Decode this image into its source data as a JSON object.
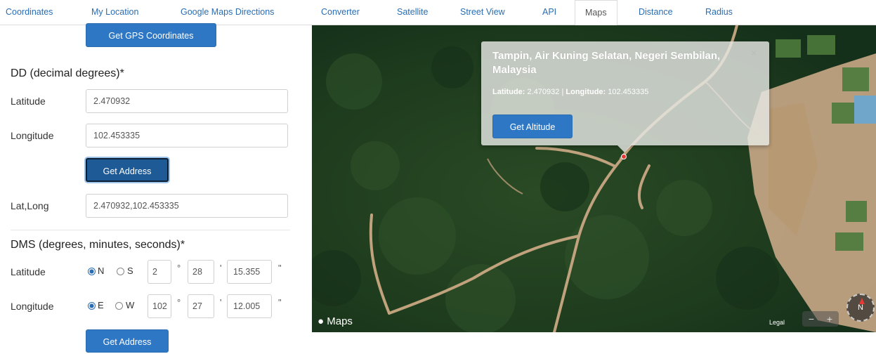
{
  "nav": {
    "tabs": [
      {
        "label": "Coordinates"
      },
      {
        "label": "My Location"
      },
      {
        "label": "Google Maps Directions"
      },
      {
        "label": "Converter"
      },
      {
        "label": "Satellite"
      },
      {
        "label": "Street View"
      },
      {
        "label": "API"
      },
      {
        "label": "Maps",
        "active": true
      },
      {
        "label": "Distance"
      },
      {
        "label": "Radius"
      }
    ]
  },
  "form": {
    "gps_button": "Get GPS Coordinates",
    "dd_heading": "DD (decimal degrees)*",
    "latitude_label": "Latitude",
    "latitude_value": "2.470932",
    "longitude_label": "Longitude",
    "longitude_value": "102.453335",
    "get_address_button": "Get Address",
    "latlong_label": "Lat,Long",
    "latlong_value": "2.470932,102.453335",
    "dms_heading": "DMS (degrees, minutes, seconds)*",
    "dms_lat": {
      "label": "Latitude",
      "dir1": "N",
      "dir2": "S",
      "selected": "N",
      "deg": "2",
      "min": "28",
      "sec": "15.355"
    },
    "dms_lon": {
      "label": "Longitude",
      "dir1": "E",
      "dir2": "W",
      "selected": "E",
      "deg": "102",
      "min": "27",
      "sec": "12.005"
    },
    "dms_get_address_button": "Get Address",
    "deg_sym": "°",
    "min_sym": "'",
    "sec_sym": "\""
  },
  "map": {
    "popup": {
      "title": "Tampin, Air Kuning Selatan, Negeri Sembilan, Malaysia",
      "lat_label": "Latitude:",
      "lat_value": "2.470932",
      "lon_label": "Longitude:",
      "lon_value": "102.453335",
      "separator": "|",
      "button": "Get Altitude",
      "close": "×"
    },
    "logo": "Maps",
    "legal": "Legal",
    "zoom_out": "−",
    "zoom_in": "+",
    "compass": "N"
  },
  "colors": {
    "link": "#2a6db3",
    "button": "#2e77c5",
    "marker": "#e53935"
  }
}
